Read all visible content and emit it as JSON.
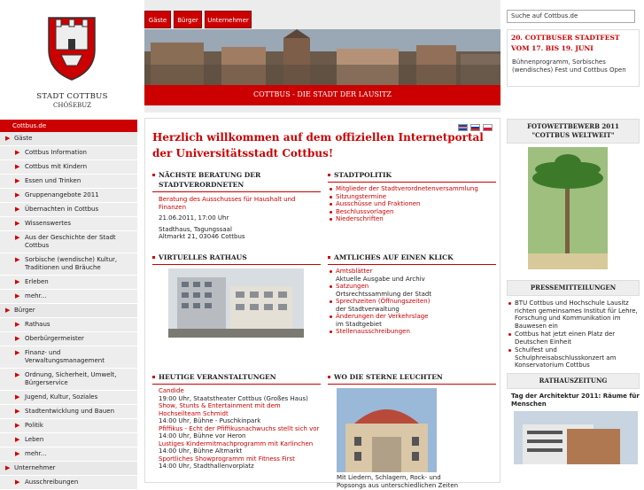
{
  "header": {
    "city": "STADT COTTBUS",
    "city_sub": "CHÓŚEBUZ",
    "nav": [
      "Gäste",
      "Bürger",
      "Unternehmer"
    ],
    "tagline": "COTTBUS - DIE STADT DER LAUSITZ",
    "search_placeholder": "Suche auf Cottbus.de"
  },
  "news": {
    "title": "20. COTTBUSER STADTFEST VOM 17. BIS 19. JUNI",
    "text": "Bühnenprogramm, Sorbisches (wendisches) Fest und Cottbus Open"
  },
  "sidebar": {
    "head": "Cottbus.de",
    "items": [
      {
        "label": "Gäste",
        "sub": false
      },
      {
        "label": "Cottbus Information",
        "sub": true
      },
      {
        "label": "Cottbus mit Kindern",
        "sub": true
      },
      {
        "label": "Essen und Trinken",
        "sub": true
      },
      {
        "label": "Gruppenangebote 2011",
        "sub": true
      },
      {
        "label": "Übernachten in Cottbus",
        "sub": true
      },
      {
        "label": "Wissenswertes",
        "sub": true
      },
      {
        "label": "Aus der Geschichte der Stadt Cottbus",
        "sub": true
      },
      {
        "label": "Sorbische (wendische) Kultur, Traditionen und Bräuche",
        "sub": true
      },
      {
        "label": "Erleben",
        "sub": true
      },
      {
        "label": "mehr...",
        "sub": true
      },
      {
        "label": "Bürger",
        "sub": false
      },
      {
        "label": "Rathaus",
        "sub": true
      },
      {
        "label": "Oberbürgermeister",
        "sub": true
      },
      {
        "label": "Finanz- und Verwaltungsmanagement",
        "sub": true
      },
      {
        "label": "Ordnung, Sicherheit, Umwelt, Bürgerservice",
        "sub": true
      },
      {
        "label": "Jugend, Kultur, Soziales",
        "sub": true
      },
      {
        "label": "Stadtentwicklung und Bauen",
        "sub": true
      },
      {
        "label": "Politik",
        "sub": true
      },
      {
        "label": "Leben",
        "sub": true
      },
      {
        "label": "mehr...",
        "sub": true
      },
      {
        "label": "Unternehmer",
        "sub": false
      },
      {
        "label": "Ausschreibungen",
        "sub": true
      }
    ]
  },
  "main": {
    "welcome": "Herzlich willkommen auf dem offiziellen Internetportal der Universitätsstadt Cottbus!",
    "beratung": {
      "title": "NÄCHSTE BERATUNG DER STADTVERORDNETEN",
      "link": "Beratung des Ausschusses für Haushalt und Finanzen",
      "date": "21.06.2011, 17:00 Uhr",
      "place": "Stadthaus, Tagungssaal",
      "addr": "Altmarkt 21, 03046 Cottbus"
    },
    "politik": {
      "title": "STADTPOLITIK",
      "links": [
        "Mitglieder der Stadtverordnetenversammlung",
        "Sitzungstermine",
        "Ausschüsse und Fraktionen",
        "Beschlussvorlagen",
        "Niederschriften"
      ]
    },
    "rathaus": {
      "title": "VIRTUELLES RATHAUS"
    },
    "amtlich": {
      "title": "AMTLICHES AUF EINEN KLICK",
      "items": [
        {
          "link": "Amtsblätter",
          "desc": "Aktuelle Ausgabe und Archiv"
        },
        {
          "link": "Satzungen",
          "desc": "Ortsrechtssammlung der Stadt"
        },
        {
          "link": "Sprechzeiten (Öffnungszeiten)",
          "desc": "der Stadtverwaltung"
        },
        {
          "link": "Änderungen der Verkehrslage",
          "desc": "im Stadtgebiet"
        },
        {
          "link": "Stellenausschreibungen",
          "desc": ""
        }
      ]
    },
    "heute": {
      "title": "HEUTIGE VERANSTALTUNGEN",
      "events": [
        {
          "name": "Candide",
          "info": "19:00 Uhr, Staatstheater Cottbus (Großes Haus)"
        },
        {
          "name": "Show, Stunts & Entertainment mit dem Hochseilteam Schmidt",
          "info": "14:00 Uhr, Bühne - Puschkinpark"
        },
        {
          "name": "Pfiffikus - Echt der Pfiffikusnachwuchs stellt sich vor",
          "info": "14:00 Uhr, Bühne vor Heron"
        },
        {
          "name": "Lustiges Kindermitmachprogramm mit Karlinchen",
          "info": "14:00 Uhr, Bühne Altmarkt"
        },
        {
          "name": "Sportliches Showprogramm mit Fitness First",
          "info": "14:00 Uhr, Stadthallenvorplatz"
        }
      ]
    },
    "sterne": {
      "title": "WO DIE STERNE LEUCHTEN",
      "caption": "Mit Liedern, Schlagern, Rock- und Popsongs aus unterschiedlichen Zeiten"
    }
  },
  "right": {
    "foto": "FOTOWETTBEWERB 2011 \"COTTBUS WELTWEIT\"",
    "presse": "PRESSEMITTEILUNGEN",
    "presse_items": [
      "BTU Cottbus und Hochschule Lausitz richten gemeinsames Institut für Lehre, Forschung und Kommunikation im Bauwesen ein",
      "Cottbus hat jetzt einen Platz der Deutschen Einheit",
      "Schulfest und Schulphreisabschlusskonzert am Konservatorium Cottbus"
    ],
    "rathauszeitung": "RATHAUSZEITUNG",
    "rz_title": "Tag der Architektur 2011: Räume für Menschen"
  },
  "colors": {
    "accent": "#cc0000"
  }
}
